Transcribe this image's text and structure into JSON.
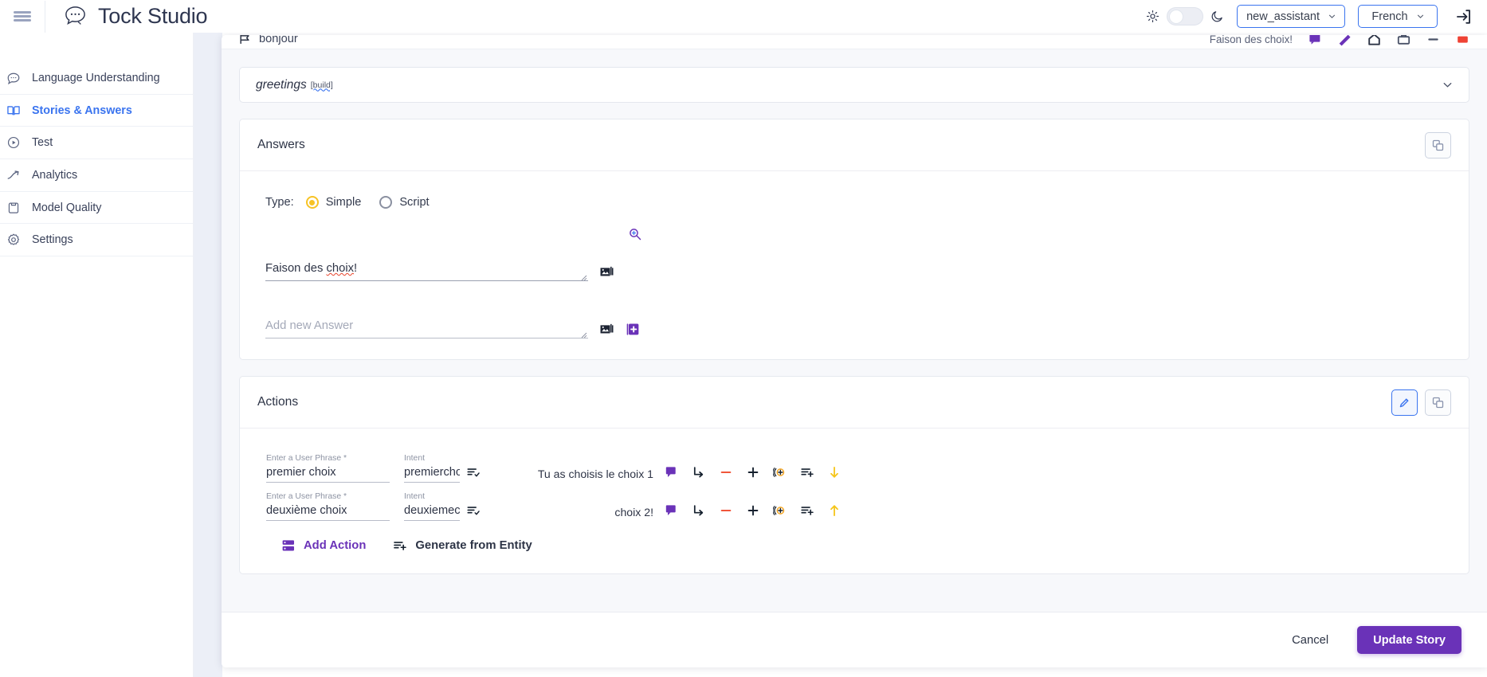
{
  "header": {
    "menu_icon": "hamburger-icon",
    "logo_icon": "chat-bubble-logo-icon",
    "title": "Tock Studio",
    "light_icon": "sun-icon",
    "dark_icon": "moon-icon",
    "theme_toggle_state": "light",
    "assistant_select": "new_assistant",
    "language_select": "French",
    "logout_icon": "logout-icon"
  },
  "sidebar": {
    "items": [
      {
        "label": "Language Understanding",
        "icon": "chat-bubble-icon",
        "active": false
      },
      {
        "label": "Stories & Answers",
        "icon": "book-icon",
        "active": true
      },
      {
        "label": "Test",
        "icon": "play-circle-icon",
        "active": false
      },
      {
        "label": "Analytics",
        "icon": "trending-up-icon",
        "active": false
      },
      {
        "label": "Model Quality",
        "icon": "clipboard-icon",
        "active": false
      },
      {
        "label": "Settings",
        "icon": "gear-icon",
        "active": false
      }
    ]
  },
  "clipped_row": {
    "flag_icon": "flag-icon",
    "label": "bonjour",
    "right_label": "Faison des choix!",
    "icons": [
      "message-icon",
      "pencil-icon",
      "home-icon",
      "briefcase-icon",
      "minus-icon",
      "delete-icon"
    ]
  },
  "story_select": {
    "name": "greetings",
    "badge": "[build]",
    "chevron_icon": "chevron-down-icon"
  },
  "answers_card": {
    "title": "Answers",
    "copy_icon": "copy-icon",
    "type_label": "Type:",
    "options": [
      {
        "label": "Simple",
        "selected": true
      },
      {
        "label": "Script",
        "selected": false
      }
    ],
    "zoom_icon": "zoom-in-icon",
    "answer_value": "Faison des choix!",
    "answer_misspelled_word": "choix",
    "answer_prefix": "Faison des ",
    "answer_suffix": "!",
    "new_answer_placeholder": "Add new Answer",
    "media_icon": "image-icon",
    "add_icon": "add-box-icon"
  },
  "actions_card": {
    "title": "Actions",
    "edit_icon": "pencil-icon",
    "copy_icon": "copy-icon",
    "columns": {
      "phrase_label": "Enter a User Phrase *",
      "intent_label": "Intent"
    },
    "rows": [
      {
        "phrase": "premier choix",
        "intent": "premierchoix",
        "intent_icon": "list-check-icon",
        "answer": "Tu as choisis le choix 1",
        "icons": [
          "message-icon",
          "arrow-return-icon",
          "minus-icon",
          "plus-icon",
          "add-circle-icon",
          "list-plus-icon",
          "arrow-down-icon"
        ]
      },
      {
        "phrase": "deuxième choix",
        "intent": "deuxiemechoix",
        "intent_icon": "list-check-icon",
        "answer": "choix 2!",
        "icons": [
          "message-icon",
          "arrow-return-icon",
          "minus-icon",
          "plus-icon",
          "add-circle-icon",
          "list-plus-icon",
          "arrow-up-icon"
        ]
      }
    ],
    "add_action_label": "Add Action",
    "add_action_icon": "server-icon",
    "generate_label": "Generate from Entity",
    "generate_icon": "list-plus-icon"
  },
  "footer": {
    "cancel_label": "Cancel",
    "update_label": "Update Story"
  },
  "colors": {
    "accent_purple": "#6a32b8",
    "accent_blue": "#3a74ef",
    "radio_yellow": "#f7c325",
    "minus_red": "#f0563a",
    "gutter": "#eceff7"
  }
}
